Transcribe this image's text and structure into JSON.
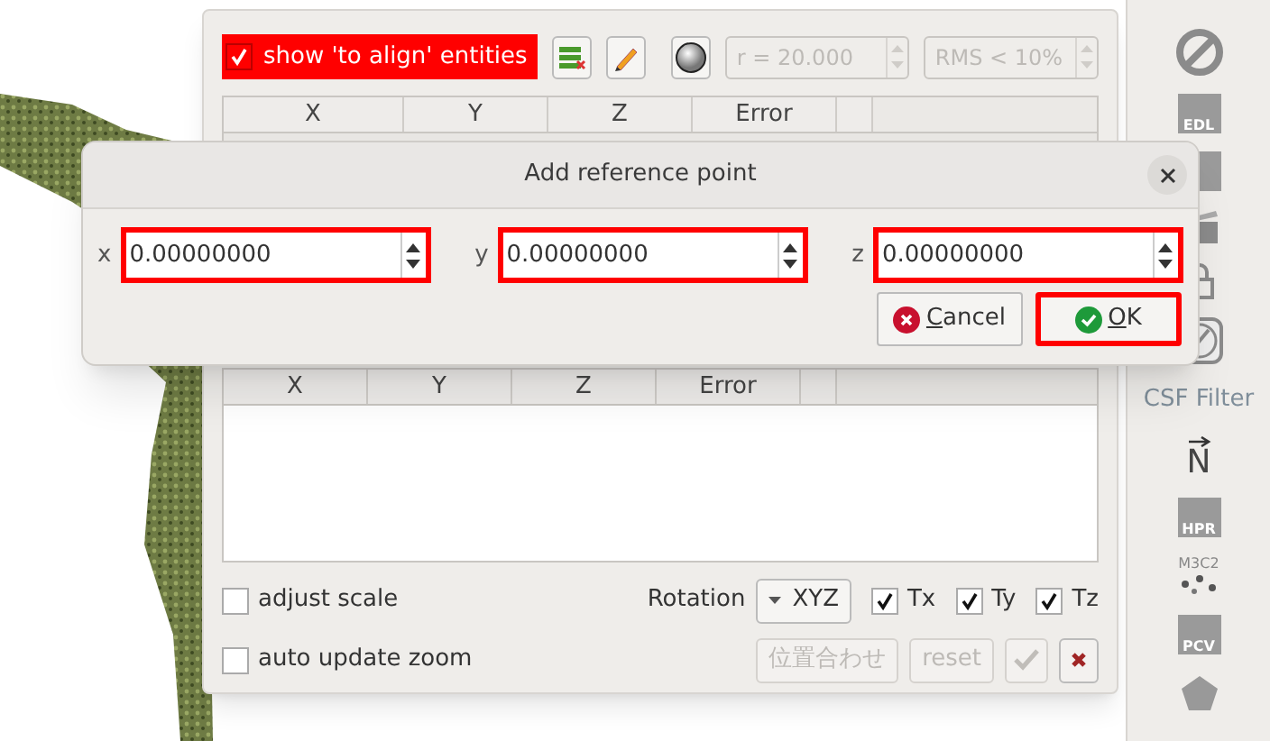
{
  "panel": {
    "show_to_align": {
      "label": "show 'to align' entities",
      "checked": true,
      "highlighted": true
    },
    "radius": {
      "value": "r = 20.000",
      "disabled": true
    },
    "rms": {
      "value": "RMS < 10%",
      "disabled": true
    },
    "upper_table": {
      "columns": [
        "X",
        "Y",
        "Z",
        "Error"
      ]
    },
    "lower_table": {
      "columns": [
        "X",
        "Y",
        "Z",
        "Error"
      ]
    },
    "adjust_scale": {
      "label": "adjust scale",
      "checked": false
    },
    "rotation": {
      "label": "Rotation",
      "value": "XYZ"
    },
    "translations": [
      {
        "label": "Tx",
        "checked": true
      },
      {
        "label": "Ty",
        "checked": true
      },
      {
        "label": "Tz",
        "checked": true
      }
    ],
    "auto_update_zoom": {
      "label": "auto update zoom",
      "checked": false
    },
    "actions": [
      {
        "kind": "text",
        "label": "位置合わせ",
        "disabled": true
      },
      {
        "kind": "text",
        "label": "reset",
        "disabled": true
      },
      {
        "kind": "apply",
        "disabled": true
      },
      {
        "kind": "cancel",
        "disabled": false
      }
    ]
  },
  "dialog": {
    "title": "Add reference point",
    "fields": [
      {
        "label": "x",
        "value": "0.00000000",
        "highlighted": true
      },
      {
        "label": "y",
        "value": "0.00000000",
        "highlighted": true
      },
      {
        "label": "z",
        "value": "0.00000000",
        "highlighted": true
      }
    ],
    "buttons": [
      {
        "kind": "cancel",
        "label": "Cancel",
        "highlighted": false
      },
      {
        "kind": "ok",
        "label": "OK",
        "highlighted": true
      }
    ]
  },
  "side_toolbar": [
    {
      "kind": "forbidden"
    },
    {
      "kind": "badge",
      "label": "EDL"
    },
    {
      "kind": "badge-hidden"
    },
    {
      "kind": "clapper"
    },
    {
      "kind": "lock"
    },
    {
      "kind": "compass"
    },
    {
      "kind": "caption",
      "label": "CSF Filter"
    },
    {
      "kind": "north",
      "label": "N"
    },
    {
      "kind": "badge",
      "label": "HPR"
    },
    {
      "kind": "dots",
      "label": "M3C2"
    },
    {
      "kind": "badge",
      "label": "PCV"
    },
    {
      "kind": "pentagon"
    }
  ]
}
